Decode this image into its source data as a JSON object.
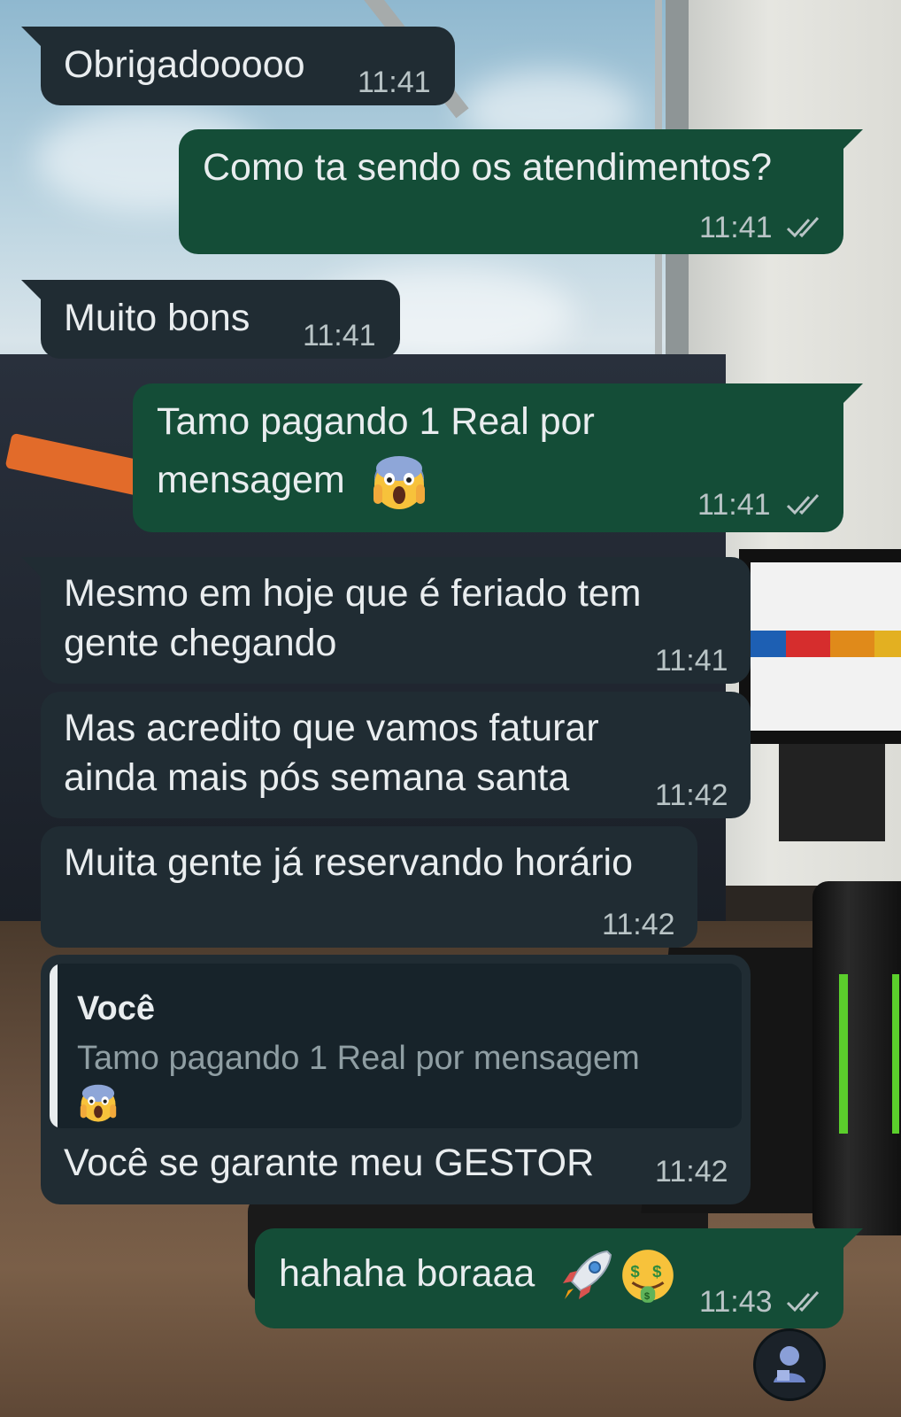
{
  "messages": [
    {
      "id": "m1",
      "direction": "incoming",
      "text": "Obrigadooooo",
      "time": "11:41"
    },
    {
      "id": "m2",
      "direction": "outgoing",
      "text": "Como ta sendo os atendimentos?",
      "time": "11:41",
      "status": "read"
    },
    {
      "id": "m3",
      "direction": "incoming",
      "text": "Muito bons",
      "time": "11:41"
    },
    {
      "id": "m4",
      "direction": "outgoing",
      "line1": "Tamo pagando 1 Real por",
      "line2": "mensagem",
      "time": "11:41",
      "status": "read",
      "emoji": "face-screaming-in-fear"
    },
    {
      "id": "m5",
      "direction": "incoming",
      "line1": "Mesmo em hoje que é feriado tem",
      "line2": "gente chegando",
      "time": "11:41"
    },
    {
      "id": "m6",
      "direction": "incoming",
      "line1": "Mas acredito que vamos faturar",
      "line2": "ainda mais pós semana santa",
      "time": "11:42"
    },
    {
      "id": "m7",
      "direction": "incoming",
      "text": "Muita gente já reservando horário",
      "time": "11:42"
    },
    {
      "id": "m8",
      "direction": "incoming",
      "quote": {
        "author": "Você",
        "text": "Tamo pagando 1 Real por mensagem",
        "emoji": "face-screaming-in-fear"
      },
      "text": "Você se garante meu GESTOR",
      "time": "11:42"
    },
    {
      "id": "m9",
      "direction": "outgoing",
      "text": "hahaha boraaa",
      "time": "11:43",
      "status": "read",
      "emojis": [
        "rocket",
        "money-mouth-face"
      ]
    }
  ],
  "colors": {
    "incoming_bubble": "#202c33",
    "outgoing_bubble": "#144d37",
    "text": "#e9edef",
    "meta": "#b9c4c6"
  },
  "icons": {
    "read_receipt": "double-check-icon",
    "avatar": "contact-avatar-icon"
  }
}
